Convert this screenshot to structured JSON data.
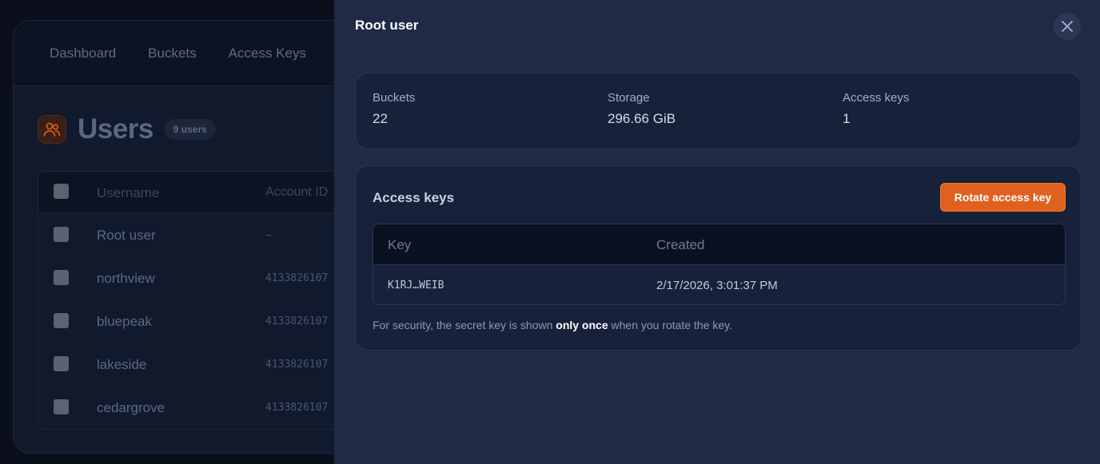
{
  "nav": {
    "items": [
      "Dashboard",
      "Buckets",
      "Access Keys"
    ]
  },
  "users_page": {
    "title": "Users",
    "count_badge": "9 users",
    "columns": [
      "Username",
      "Account ID"
    ],
    "rows": [
      {
        "username": "Root user",
        "account_id": "–"
      },
      {
        "username": "northview",
        "account_id": "4133826107"
      },
      {
        "username": "bluepeak",
        "account_id": "4133826107"
      },
      {
        "username": "lakeside",
        "account_id": "4133826107"
      },
      {
        "username": "cedargrove",
        "account_id": "4133826107"
      }
    ]
  },
  "drawer": {
    "title": "Root user",
    "stats": [
      {
        "label": "Buckets",
        "value": "22"
      },
      {
        "label": "Storage",
        "value": "296.66 GiB"
      },
      {
        "label": "Access keys",
        "value": "1"
      }
    ],
    "access_keys": {
      "title": "Access keys",
      "rotate_label": "Rotate access key",
      "columns": {
        "key": "Key",
        "created": "Created"
      },
      "rows": [
        {
          "key": "K1RJ…WEIB",
          "created": "2/17/2026, 3:01:37 PM"
        }
      ],
      "note_prefix": "For security, the secret key is shown ",
      "note_bold": "only once",
      "note_suffix": " when you rotate the key."
    }
  },
  "colors": {
    "accent": "#e0601e",
    "drawer_bg": "#1f2b45",
    "card_bg": "#17213a",
    "app_bg": "#0a0f1b"
  },
  "icons": [
    "users-icon",
    "close-icon"
  ]
}
